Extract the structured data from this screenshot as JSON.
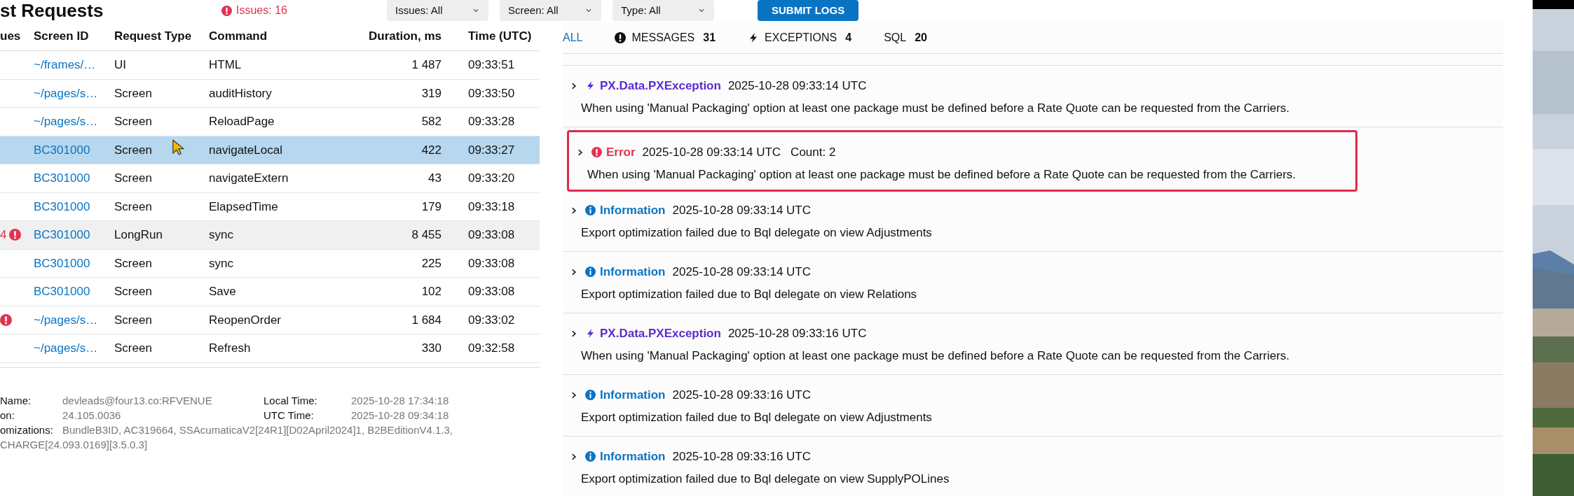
{
  "header": {
    "title": "st Requests",
    "issues": "Issues: 16",
    "filters": [
      "Issues: All",
      "Screen: All",
      "Type: All"
    ],
    "submit": "SUBMIT LOGS"
  },
  "table": {
    "columns": [
      "ues",
      "Screen ID",
      "Request Type",
      "Command",
      "Duration, ms",
      "Time (UTC)"
    ],
    "rows": [
      {
        "flag": false,
        "screen_id": "~/frames/…",
        "type": "UI",
        "command": "HTML",
        "duration": "1 487",
        "time": "09:33:51",
        "selected": false,
        "highlighted": false
      },
      {
        "flag": false,
        "screen_id": "~/pages/s…",
        "type": "Screen",
        "command": "auditHistory",
        "duration": "319",
        "time": "09:33:50",
        "selected": false,
        "highlighted": false
      },
      {
        "flag": false,
        "screen_id": "~/pages/s…",
        "type": "Screen",
        "command": "ReloadPage",
        "duration": "582",
        "time": "09:33:28",
        "selected": false,
        "highlighted": false
      },
      {
        "flag": false,
        "screen_id": "BC301000",
        "type": "Screen",
        "command": "navigateLocal",
        "duration": "422",
        "time": "09:33:27",
        "selected": true,
        "highlighted": false
      },
      {
        "flag": false,
        "screen_id": "BC301000",
        "type": "Screen",
        "command": "navigateExtern",
        "duration": "43",
        "time": "09:33:20",
        "selected": false,
        "highlighted": false
      },
      {
        "flag": false,
        "screen_id": "BC301000",
        "type": "Screen",
        "command": "ElapsedTime",
        "duration": "179",
        "time": "09:33:18",
        "selected": false,
        "highlighted": false
      },
      {
        "issues": "4",
        "flag": true,
        "screen_id": "BC301000",
        "type": "LongRun",
        "command": "sync",
        "duration": "8 455",
        "time": "09:33:08",
        "selected": false,
        "highlighted": true
      },
      {
        "flag": false,
        "screen_id": "BC301000",
        "type": "Screen",
        "command": "sync",
        "duration": "225",
        "time": "09:33:08",
        "selected": false,
        "highlighted": false
      },
      {
        "flag": false,
        "screen_id": "BC301000",
        "type": "Screen",
        "command": "Save",
        "duration": "102",
        "time": "09:33:08",
        "selected": false,
        "highlighted": false
      },
      {
        "flag": true,
        "screen_id": "~/pages/s…",
        "type": "Screen",
        "command": "ReopenOrder",
        "duration": "1 684",
        "time": "09:33:02",
        "selected": false,
        "highlighted": false
      },
      {
        "flag": false,
        "screen_id": "~/pages/s…",
        "type": "Screen",
        "command": "Refresh",
        "duration": "330",
        "time": "09:32:58",
        "selected": false,
        "highlighted": false
      }
    ]
  },
  "info": {
    "left": [
      {
        "label": "Name:",
        "value": "devleads@four13.co:RFVENUE"
      },
      {
        "label": "on:",
        "value": "24.105.0036"
      }
    ],
    "right": [
      {
        "label": "Local Time:",
        "value": "2025-10-28 17:34:18"
      },
      {
        "label": "UTC Time:",
        "value": "2025-10-28 09:34:18"
      }
    ],
    "customizations": {
      "label": "omizations:",
      "value": "BundleB3ID, AC319664, SSAcumaticaV2[24R1][D02April2024]1, B2BEditionV4.1.3,",
      "continued": "CHARGE[24.093.0169][3.5.0.3]"
    }
  },
  "log": {
    "tabs": [
      {
        "kind": "plain",
        "label": "ALL",
        "selected": true
      },
      {
        "kind": "message",
        "label": "MESSAGES",
        "count": "31",
        "selected": false
      },
      {
        "kind": "exception",
        "label": "EXCEPTIONS",
        "count": "4",
        "selected": false
      },
      {
        "kind": "plain",
        "label": "SQL",
        "count": "20",
        "selected": false
      }
    ],
    "entries": [
      {
        "kind": "exception",
        "title": "PX.Data.PXException",
        "time": "2025-10-28 09:33:14 UTC",
        "message": "When using 'Manual Packaging' option at least one package must be defined before a Rate Quote can be requested from the Carriers.",
        "highlighted": false
      },
      {
        "kind": "error",
        "title": "Error",
        "time": "2025-10-28 09:33:14 UTC",
        "count": "Count: 2",
        "message": "When using 'Manual Packaging' option at least one package must be defined before a Rate Quote can be requested from the Carriers.",
        "highlighted": true
      },
      {
        "kind": "information",
        "title": "Information",
        "time": "2025-10-28 09:33:14 UTC",
        "message": "Export optimization failed due to Bql delegate on view Adjustments",
        "highlighted": false
      },
      {
        "kind": "information",
        "title": "Information",
        "time": "2025-10-28 09:33:14 UTC",
        "message": "Export optimization failed due to Bql delegate on view Relations",
        "highlighted": false
      },
      {
        "kind": "exception",
        "title": "PX.Data.PXException",
        "time": "2025-10-28 09:33:16 UTC",
        "message": "When using 'Manual Packaging' option at least one package must be defined before a Rate Quote can be requested from the Carriers.",
        "highlighted": false
      },
      {
        "kind": "information",
        "title": "Information",
        "time": "2025-10-28 09:33:16 UTC",
        "message": "Export optimization failed due to Bql delegate on view Adjustments",
        "highlighted": false
      },
      {
        "kind": "information",
        "title": "Information",
        "time": "2025-10-28 09:33:16 UTC",
        "message": "Export optimization failed due to Bql delegate on view SupplyPOLines",
        "highlighted": false
      }
    ]
  }
}
